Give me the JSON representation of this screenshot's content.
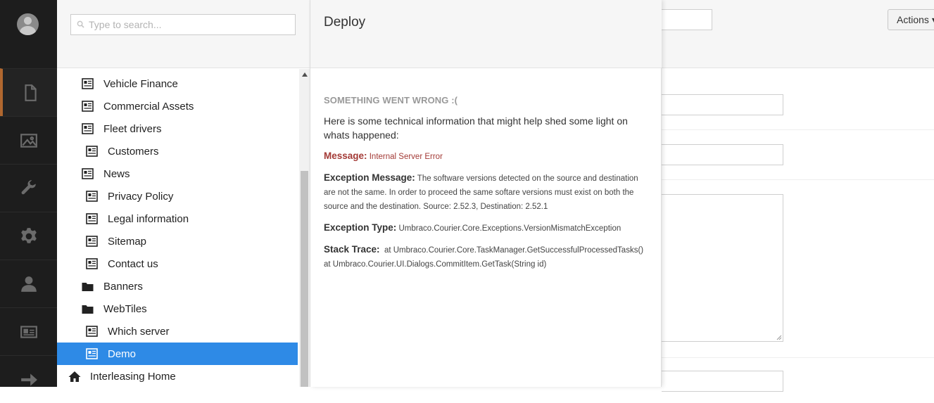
{
  "search": {
    "placeholder": "Type to search..."
  },
  "editor": {
    "actions_label": "Actions"
  },
  "tree": {
    "items": [
      {
        "label": "Vehicle Finance",
        "type": "page"
      },
      {
        "label": "Commercial Assets",
        "type": "page"
      },
      {
        "label": "Fleet drivers",
        "type": "page"
      },
      {
        "label": "Customers",
        "type": "page"
      },
      {
        "label": "News",
        "type": "page"
      },
      {
        "label": "Privacy Policy",
        "type": "page"
      },
      {
        "label": "Legal information",
        "type": "page"
      },
      {
        "label": "Sitemap",
        "type": "page"
      },
      {
        "label": "Contact us",
        "type": "page"
      },
      {
        "label": "Banners",
        "type": "folder"
      },
      {
        "label": "WebTiles",
        "type": "folder"
      },
      {
        "label": "Which server",
        "type": "page"
      },
      {
        "label": "Demo",
        "type": "page",
        "selected": true
      },
      {
        "label": "Interleasing Home",
        "type": "home"
      }
    ]
  },
  "dialog": {
    "title": "Deploy",
    "error_title": "SOMETHING WENT WRONG :(",
    "intro": "Here is some technical information that might help shed some light on whats happened:",
    "message_label": "Message:",
    "message_value": "Internal Server Error",
    "exception_message_label": "Exception Message:",
    "exception_message_value": "The software versions detected on the source and destination are not the same. In order to proceed the same softare versions must exist on both the source and the destination. Source: 2.52.3, Destination: 2.52.1",
    "exception_type_label": "Exception Type:",
    "exception_type_value": "Umbraco.Courier.Core.Exceptions.VersionMismatchException",
    "stack_trace_label": "Stack Trace:",
    "stack_trace_value": "at Umbraco.Courier.Core.TaskManager.GetSuccessfulProcessedTasks() at Umbraco.Courier.UI.Dialogs.CommitItem.GetTask(String id)"
  },
  "colors": {
    "selected_row": "#2e8ae6",
    "nav_active_accent": "#b0672f",
    "error_red": "#a33a36"
  },
  "nav_icons": [
    "content-icon",
    "media-icon",
    "developer-icon",
    "settings-icon",
    "users-icon",
    "members-icon",
    "deploy-arrow-icon"
  ]
}
